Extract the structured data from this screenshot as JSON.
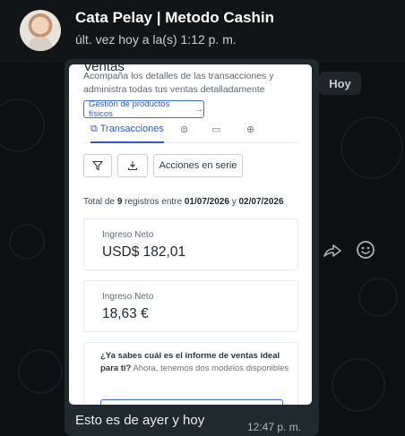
{
  "header": {
    "contact_name": "Cata Pelay | Metodo Cashin",
    "last_seen": "últ. vez hoy a la(s) 1:12 p. m."
  },
  "date_chip": "Hoy",
  "message": {
    "caption": "Esto es de ayer y hoy",
    "time": "12:47 p. m."
  },
  "screenshot": {
    "title": "Ventas",
    "description": "Acompaña los detalles de las transacciones y administra todas tus ventas detalladamente",
    "physical_products_button": "Gestión de productos físicos",
    "tabs": [
      {
        "label": "Transacciones",
        "icon": "copy-icon",
        "active": true
      },
      {
        "label": "",
        "icon": "dollar-icon",
        "active": false
      },
      {
        "label": "",
        "icon": "card-icon",
        "active": false
      },
      {
        "label": "",
        "icon": "globe-icon",
        "active": false
      }
    ],
    "bulk_actions_button": "Acciones en serie",
    "summary": {
      "prefix": "Total de",
      "count": "9",
      "middle": "registros entre",
      "start_date": "01/07/2026",
      "conjunction": "y",
      "end_date": "02/07/2026"
    },
    "metrics": [
      {
        "label": "Ingreso Neto",
        "value": "USD$ 182,01"
      },
      {
        "label": "Ingreso Neto",
        "value": "18,63 €"
      }
    ],
    "promo": {
      "bold": "¿Ya sabes cuál es el informe de ventas ideal para ti?",
      "rest": "Ahora, tenemos dos modelos disponibles"
    }
  },
  "colors": {
    "bubble": "#202a2e",
    "accent_blue": "#2b5bc4",
    "header_bg": "#111517"
  }
}
